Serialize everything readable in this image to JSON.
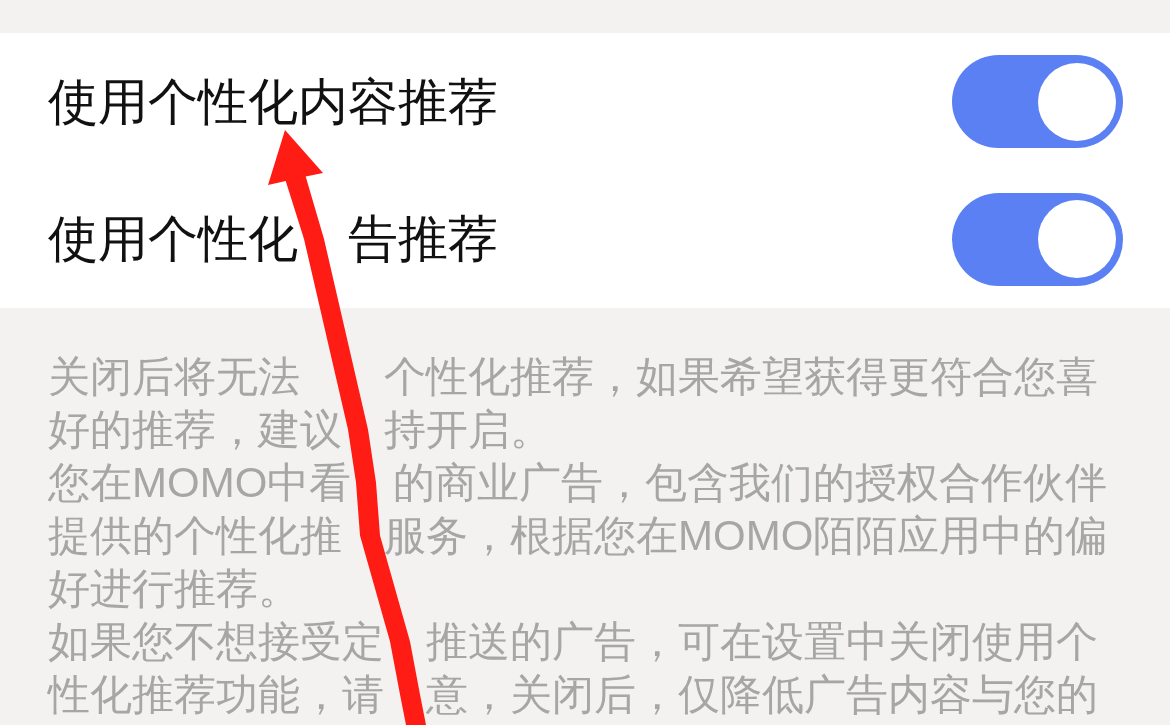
{
  "settings": [
    {
      "label": "使用个性化内容推荐",
      "on": true
    },
    {
      "label": "使用个性化　告推荐",
      "on": true
    }
  ],
  "description": [
    "关闭后将无法　　个性化推荐，如果希望获得更符合您喜好的推荐，建议　持开启。",
    "您在MOMO中看　的商业广告，包含我们的授权合作伙伴提供的个性化推　服务，根据您在MOMO陌陌应用中的偏好进行推荐。",
    "如果您不想接受定　推送的广告，可在设置中关闭使用个性化推荐功能，请　意，关闭后，仅降低广告内容与您的"
  ]
}
